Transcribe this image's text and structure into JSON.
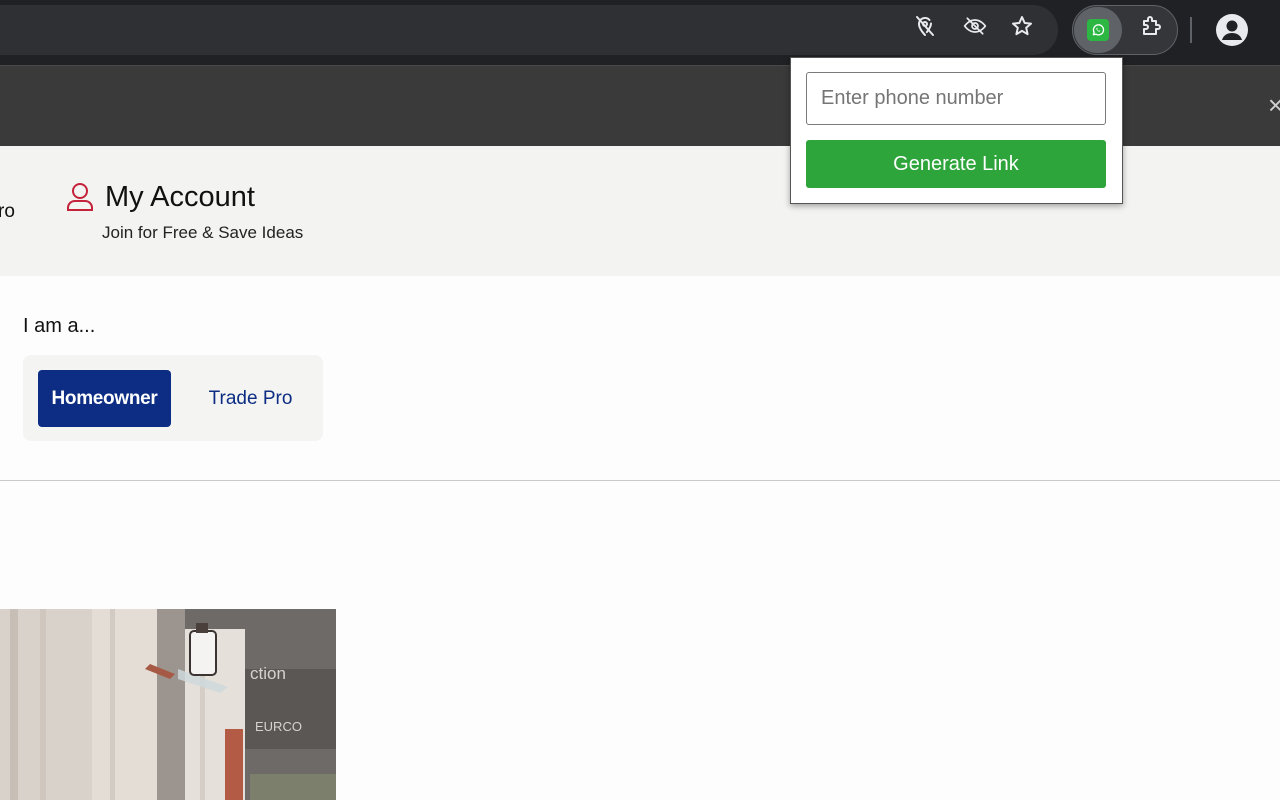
{
  "browser": {
    "icons": [
      "location-off-icon",
      "eye-off-icon",
      "star-icon",
      "whatsapp-extension-icon",
      "extensions-puzzle-icon",
      "profile-avatar-icon"
    ]
  },
  "banner": {
    "close_label": "×"
  },
  "header": {
    "left_fragment": "ro",
    "account_title": "My Account",
    "account_subtitle": "Join for Free & Save Ideas"
  },
  "role_select": {
    "label": "I am a...",
    "options": [
      "Homeowner",
      "Trade Pro"
    ],
    "selected": "Homeowner"
  },
  "popup": {
    "phone_placeholder": "Enter phone number",
    "phone_value": "",
    "generate_label": "Generate Link"
  },
  "colors": {
    "accent_blue": "#0c2d83",
    "generate_green": "#2da53a",
    "account_icon_red": "#c4223a"
  }
}
